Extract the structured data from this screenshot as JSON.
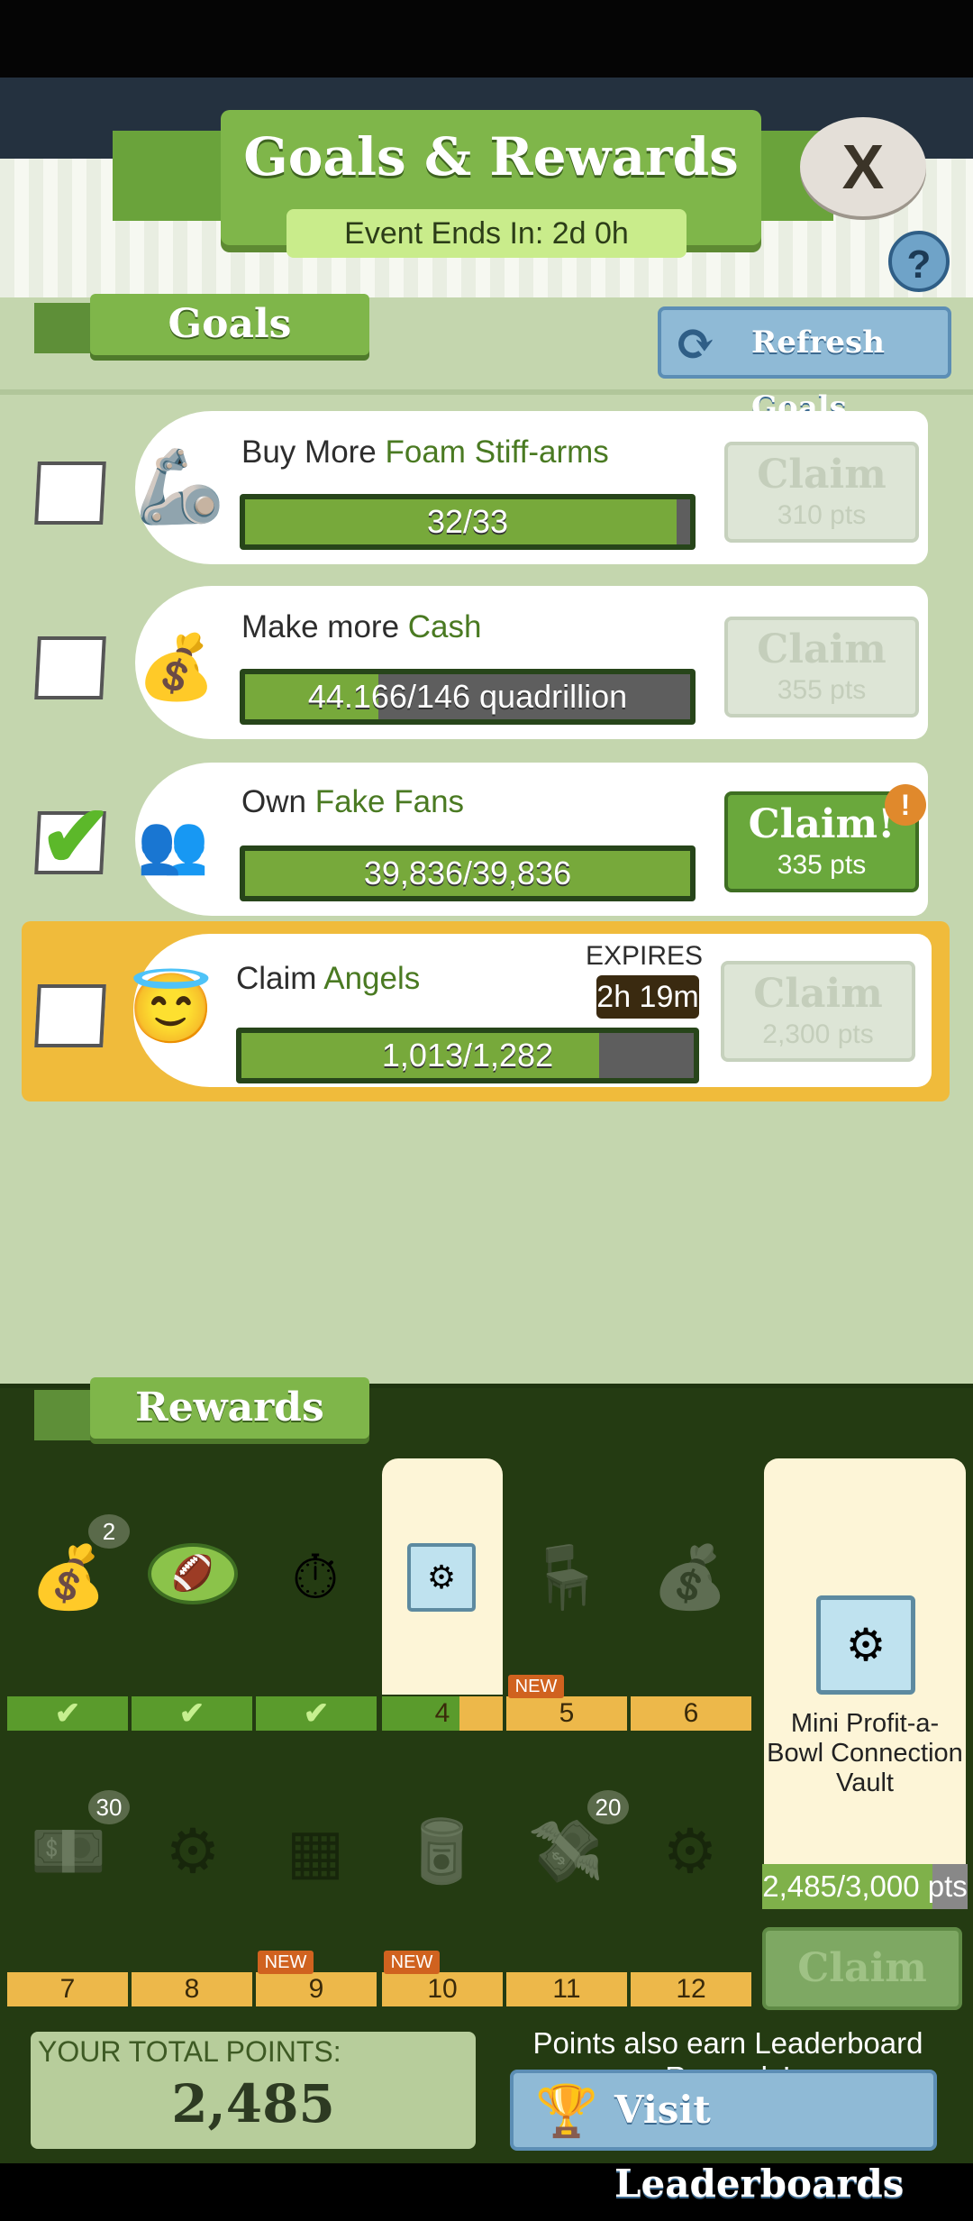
{
  "header": {
    "title": "Goals & Rewards",
    "event_ends": "Event Ends In: 2d 0h",
    "close_label": "X",
    "help_label": "?"
  },
  "goals_section": {
    "title": "Goals",
    "refresh_label": "Refresh Goals",
    "goals": [
      {
        "prefix": "Buy More ",
        "item": "Foam Stiff-arms",
        "progress_text": "32/33",
        "progress": 0.97,
        "claim": "Claim",
        "points": "310 pts",
        "checked": false,
        "icon": "foam-arm-icon"
      },
      {
        "prefix": "Make more ",
        "item": "Cash",
        "progress_text": "44.166/146 quadrillion",
        "progress": 0.3,
        "claim": "Claim",
        "points": "355 pts",
        "checked": false,
        "icon": "money-bags-icon"
      },
      {
        "prefix": "Own ",
        "item": "Fake Fans",
        "progress_text": "39,836/39,836",
        "progress": 1.0,
        "claim": "Claim!",
        "points": "335 pts",
        "checked": true,
        "icon": "fake-fans-icon"
      },
      {
        "prefix": "Claim ",
        "item": "Angels",
        "progress_text": "1,013/1,282",
        "progress": 0.79,
        "claim": "Claim",
        "points": "2,300 pts",
        "checked": false,
        "icon": "angel-icon",
        "expires_label": "EXPIRES IN",
        "expires_time": "2h 19m"
      }
    ]
  },
  "rewards_section": {
    "title": "Rewards",
    "row1": [
      {
        "tier": "",
        "done": true,
        "icon": "gold-pile-icon",
        "count": "2"
      },
      {
        "tier": "",
        "done": true,
        "icon": "football-icon",
        "count": ""
      },
      {
        "tier": "",
        "done": true,
        "icon": "stopwatch-icon",
        "count": ""
      },
      {
        "tier": "4",
        "done": false,
        "icon": "vault-icon",
        "count": "",
        "current": true
      },
      {
        "tier": "5",
        "done": false,
        "icon": "chair-icon",
        "count": "",
        "new": "NEW"
      },
      {
        "tier": "6",
        "done": false,
        "icon": "money-bag-1d-icon",
        "count": ""
      }
    ],
    "row2": [
      {
        "tier": "7",
        "icon": "megabucks-bill-icon",
        "count": "30"
      },
      {
        "tier": "8",
        "icon": "vault-icon",
        "count": ""
      },
      {
        "tier": "9",
        "icon": "table-icon",
        "count": "",
        "new": "NEW"
      },
      {
        "tier": "10",
        "icon": "cash-can-icon",
        "count": "",
        "new": "NEW"
      },
      {
        "tier": "11",
        "icon": "cash-pile-icon",
        "count": "20"
      },
      {
        "tier": "12",
        "icon": "vault-icon",
        "count": ""
      }
    ],
    "featured": {
      "name": "Mini Profit-a-Bowl Connection Vault",
      "points": "2,485/3,000 pts",
      "progress": 0.83,
      "claim": "Claim"
    }
  },
  "footer": {
    "total_label": "YOUR TOTAL POINTS:",
    "total_value": "2,485",
    "leaderboard_text": "Points also earn Leaderboard Rewards!",
    "leaderboard_button": "Visit Leaderboards"
  }
}
